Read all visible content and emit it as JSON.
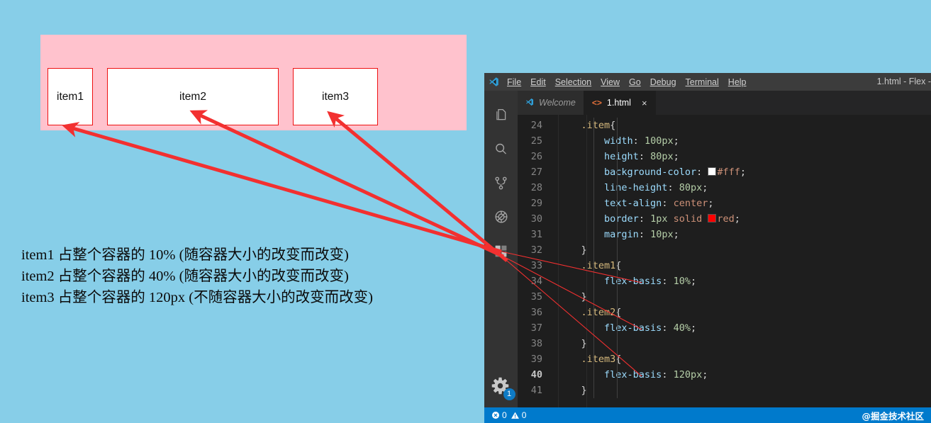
{
  "demo": {
    "container_color": "#ffc2cd",
    "page_background": "#87cee8",
    "item_border_color": "#ee1111",
    "items": [
      {
        "label": "item1",
        "basis": "10%"
      },
      {
        "label": "item2",
        "basis": "40%"
      },
      {
        "label": "item3",
        "basis": "120px"
      }
    ]
  },
  "legend": {
    "lines": [
      "item1  占整个容器的  10%  (随容器大小的改变而改变)",
      "item2  占整个容器的  40%  (随容器大小的改变而改变)",
      "item3  占整个容器的  120px  (不随容器大小的改变而改变)"
    ]
  },
  "vscode": {
    "window_title": "1.html - Flex -",
    "menu": [
      "File",
      "Edit",
      "Selection",
      "View",
      "Go",
      "Debug",
      "Terminal",
      "Help"
    ],
    "activity_icons": [
      "explorer-icon",
      "search-icon",
      "source-control-icon",
      "debug-icon",
      "extensions-icon"
    ],
    "settings_badge": "1",
    "tabs": [
      {
        "label": "Welcome",
        "active": false,
        "icon": "vscode-logo-icon"
      },
      {
        "label": "1.html",
        "active": true,
        "icon": "code-brackets-icon",
        "close": "×"
      }
    ],
    "code": [
      {
        "num": "24",
        "indent": 1,
        "tokens": [
          {
            "t": ".item",
            "c": "sel"
          },
          {
            "t": "{",
            "c": "brace"
          }
        ]
      },
      {
        "num": "25",
        "indent": 2,
        "tokens": [
          {
            "t": "width",
            "c": "prop"
          },
          {
            "t": ": ",
            "c": "punc"
          },
          {
            "t": "100px",
            "c": "val"
          },
          {
            "t": ";",
            "c": "punc"
          }
        ]
      },
      {
        "num": "26",
        "indent": 2,
        "tokens": [
          {
            "t": "height",
            "c": "prop"
          },
          {
            "t": ": ",
            "c": "punc"
          },
          {
            "t": "80px",
            "c": "val"
          },
          {
            "t": ";",
            "c": "punc"
          }
        ]
      },
      {
        "num": "27",
        "indent": 2,
        "tokens": [
          {
            "t": "background-color",
            "c": "prop"
          },
          {
            "t": ": ",
            "c": "punc"
          },
          {
            "t": "#fff",
            "c": "kw",
            "swatch": "#ffffff"
          },
          {
            "t": ";",
            "c": "punc"
          }
        ]
      },
      {
        "num": "28",
        "indent": 2,
        "tokens": [
          {
            "t": "line-height",
            "c": "prop"
          },
          {
            "t": ": ",
            "c": "punc"
          },
          {
            "t": "80px",
            "c": "val"
          },
          {
            "t": ";",
            "c": "punc"
          }
        ]
      },
      {
        "num": "29",
        "indent": 2,
        "tokens": [
          {
            "t": "text-align",
            "c": "prop"
          },
          {
            "t": ": ",
            "c": "punc"
          },
          {
            "t": "center",
            "c": "kw"
          },
          {
            "t": ";",
            "c": "punc"
          }
        ]
      },
      {
        "num": "30",
        "indent": 2,
        "tokens": [
          {
            "t": "border",
            "c": "prop"
          },
          {
            "t": ": ",
            "c": "punc"
          },
          {
            "t": "1px",
            "c": "val"
          },
          {
            "t": " ",
            "c": "punc"
          },
          {
            "t": "solid",
            "c": "kw"
          },
          {
            "t": " ",
            "c": "punc"
          },
          {
            "t": "red",
            "c": "kw",
            "swatch": "#ff0000"
          },
          {
            "t": ";",
            "c": "punc"
          }
        ]
      },
      {
        "num": "31",
        "indent": 2,
        "tokens": [
          {
            "t": "margin",
            "c": "prop"
          },
          {
            "t": ": ",
            "c": "punc"
          },
          {
            "t": "10px",
            "c": "val"
          },
          {
            "t": ";",
            "c": "punc"
          }
        ]
      },
      {
        "num": "32",
        "indent": 1,
        "tokens": [
          {
            "t": "}",
            "c": "brace"
          }
        ]
      },
      {
        "num": "33",
        "indent": 1,
        "tokens": [
          {
            "t": ".item1",
            "c": "sel"
          },
          {
            "t": "{",
            "c": "brace"
          }
        ]
      },
      {
        "num": "34",
        "indent": 2,
        "tokens": [
          {
            "t": "flex-basis",
            "c": "prop"
          },
          {
            "t": ": ",
            "c": "punc"
          },
          {
            "t": "10%",
            "c": "val"
          },
          {
            "t": ";",
            "c": "punc"
          }
        ]
      },
      {
        "num": "35",
        "indent": 1,
        "tokens": [
          {
            "t": "}",
            "c": "brace"
          }
        ]
      },
      {
        "num": "36",
        "indent": 1,
        "tokens": [
          {
            "t": ".item2",
            "c": "sel"
          },
          {
            "t": "{",
            "c": "brace"
          }
        ]
      },
      {
        "num": "37",
        "indent": 2,
        "tokens": [
          {
            "t": "flex-basis",
            "c": "prop"
          },
          {
            "t": ": ",
            "c": "punc"
          },
          {
            "t": "40%",
            "c": "val"
          },
          {
            "t": ";",
            "c": "punc"
          }
        ]
      },
      {
        "num": "38",
        "indent": 1,
        "tokens": [
          {
            "t": "}",
            "c": "brace"
          }
        ]
      },
      {
        "num": "39",
        "indent": 1,
        "tokens": [
          {
            "t": ".item3",
            "c": "sel"
          },
          {
            "t": "{",
            "c": "brace"
          }
        ]
      },
      {
        "num": "40",
        "indent": 2,
        "current": true,
        "tokens": [
          {
            "t": "flex-basis",
            "c": "prop"
          },
          {
            "t": ": ",
            "c": "punc"
          },
          {
            "t": "120px",
            "c": "val"
          },
          {
            "t": ";",
            "c": "punc"
          }
        ]
      },
      {
        "num": "41",
        "indent": 1,
        "tokens": [
          {
            "t": "}",
            "c": "brace"
          }
        ]
      }
    ],
    "status": {
      "errors": "0",
      "warnings": "0",
      "watermark": "@掘金技术社区",
      "accent": "#007acc"
    }
  },
  "annotations": {
    "arrow_color": "#f23030",
    "arrow_count": 3
  }
}
